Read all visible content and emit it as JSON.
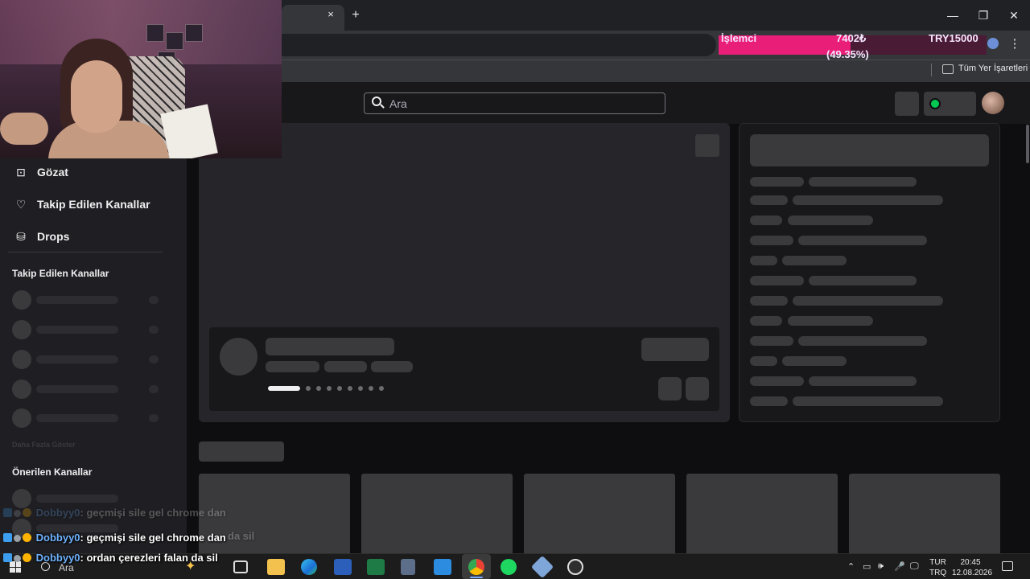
{
  "browser": {
    "new_tab_symbol": "+",
    "close_tab_symbol": "×",
    "window_buttons": [
      "—",
      "❐",
      "✕"
    ],
    "menu_symbol": "⋮",
    "bookmarks_folder": "Tüm Yer İşaretleri"
  },
  "cpu_overlay": {
    "label": "İşlemci",
    "value": "7402₺",
    "percent_text": "(49.35%)",
    "target": "TRY15000",
    "fill_fraction": 0.4935,
    "fill_color": "#e91e78"
  },
  "twitch": {
    "search_placeholder": "Ara",
    "sidebar": {
      "nav": [
        {
          "icon": "browse-icon",
          "glyph": "⊡",
          "label": "Gözat"
        },
        {
          "icon": "heart-icon",
          "glyph": "♡",
          "label": "Takip Edilen Kanallar"
        },
        {
          "icon": "drops-icon",
          "glyph": "⛁",
          "label": "Drops"
        }
      ],
      "followed_heading": "Takip Edilen Kanallar",
      "show_more": "Daha Fazla Göster",
      "recommended_heading": "Önerilen Kanallar"
    },
    "accent_color": "#9147ff"
  },
  "chat": [
    {
      "user": "Dobbyy0",
      "message": ": geçmişi sile gel chrome dan",
      "faded": true
    },
    {
      "user": "",
      "message": "da sil",
      "faded": true
    },
    {
      "user": "Dobbyy0",
      "message": ": geçmişi sile gel chrome dan",
      "faded": false
    },
    {
      "user": "Dobbyy0",
      "message": ": ordan çerezleri falan da sil",
      "faded": false
    }
  ],
  "taskbar": {
    "search_label": "Ara",
    "apps": [
      "task-view-icon",
      "file-explorer-icon",
      "edge-icon",
      "word-icon",
      "excel-icon",
      "calculator-icon",
      "store-icon",
      "chrome-icon",
      "spotify-icon",
      "app-icon",
      "obs-icon"
    ],
    "tray_symbols": [
      "⌃",
      "▭",
      "🕪",
      "🎤",
      "🖵"
    ],
    "language_top": "TUR",
    "language_bottom": "TRQ",
    "time": "20:45",
    "date": "12.08.2026"
  }
}
